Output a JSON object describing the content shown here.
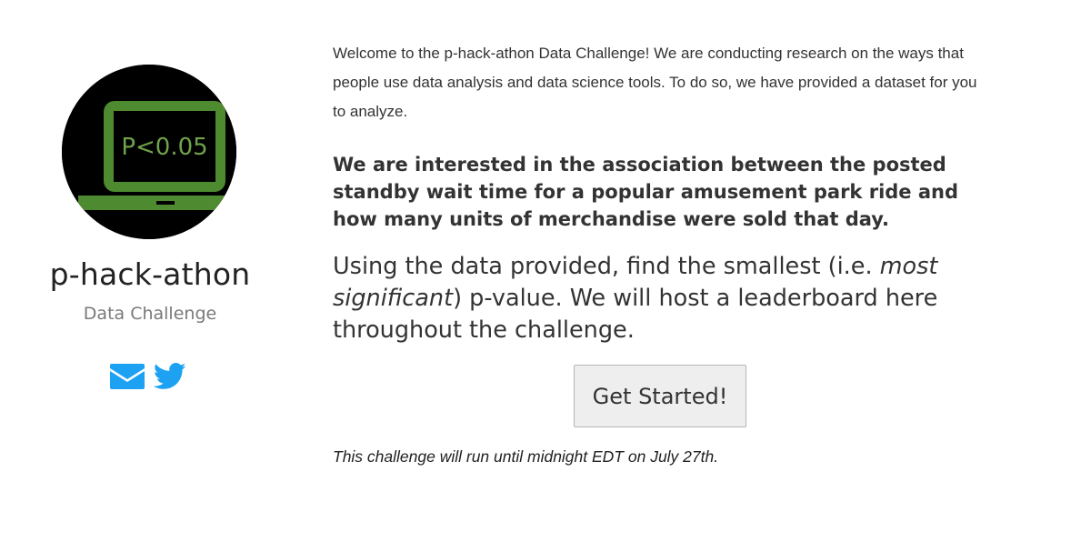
{
  "sidebar": {
    "logo_text": "P<0.05",
    "title": "p-hack-athon",
    "subtitle": "Data Challenge",
    "social": [
      {
        "icon": "envelope-icon",
        "color": "#1da1f2"
      },
      {
        "icon": "twitter-bird-icon",
        "color": "#1da1f2"
      }
    ]
  },
  "main": {
    "intro": "Welcome to the p-hack-athon Data Challenge! We are conducting research on the ways that people use data analysis and data science tools. To do so, we have provided a dataset for you to analyze.",
    "question": "We are interested in the association between the posted standby wait time for a popular amusement park ride and how many units of merchandise were sold that day.",
    "task_before": "Using the data provided, find the smallest (i.e. ",
    "task_emphasis": "most significant",
    "task_after": ") p-value. We will host a leaderboard here throughout the challenge.",
    "button_label": "Get Started!",
    "deadline": "This challenge will run until midnight EDT on July 27th."
  },
  "colors": {
    "logo_green": "#4e8a2f",
    "logo_text_green": "#6fa24a",
    "accent_blue": "#1da1f2"
  }
}
